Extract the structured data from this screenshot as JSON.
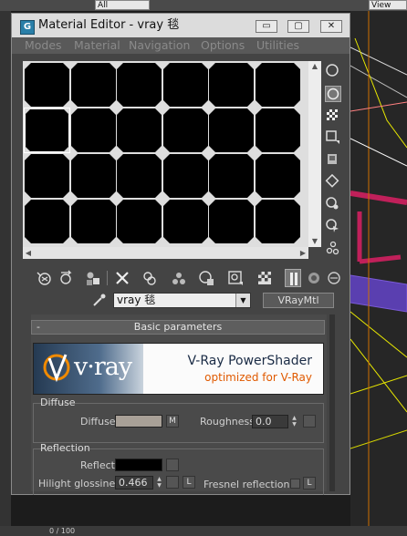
{
  "background": {
    "dropdown_all": "All",
    "dropdown_view": "View",
    "status_text": "0 / 100"
  },
  "window": {
    "title": "Material Editor - vray 毯",
    "icon_letter": "G",
    "controls": {
      "minimize": "▭",
      "maximize": "▢",
      "close": "✕"
    }
  },
  "menu": [
    "Modes",
    "Material",
    "Navigation",
    "Options",
    "Utilities"
  ],
  "samples": {
    "rows": 4,
    "cols": 6,
    "active_index": 6,
    "slot_color": "#000000"
  },
  "right_tools": [
    "sample-type-sphere-icon",
    "backlight-icon",
    "background-checker-icon",
    "sample-uv-tiling-icon",
    "video-color-check-icon",
    "make-preview-icon",
    "options-icon",
    "select-by-material-icon",
    "material-map-navigator-icon"
  ],
  "bottom_tools": [
    "get-material-icon",
    "put-to-scene-icon",
    "assign-to-selection-icon",
    "reset-map-icon",
    "make-unique-icon",
    "put-to-library-icon",
    "material-id-channel-icon",
    "show-map-in-viewport-icon",
    "show-end-result-icon",
    "go-to-parent-icon",
    "go-forward-to-sibling-icon"
  ],
  "material": {
    "name": "vray 毯",
    "type": "VRayMtl"
  },
  "rollout": {
    "minus": "-",
    "title": "Basic parameters"
  },
  "logo": {
    "word": "v·ray",
    "line1": "V-Ray PowerShader",
    "line2": "optimized for V-Ray"
  },
  "diffuse": {
    "group_title": "Diffuse",
    "label": "Diffuse",
    "color": "#a8a097",
    "map_button": "M",
    "roughness_label": "Roughness",
    "roughness_value": "0.0"
  },
  "reflection": {
    "group_title": "Reflection",
    "reflect_label": "Reflect",
    "reflect_color": "#000000",
    "hilight_label": "Hilight glossiness",
    "hilight_value": "0.466",
    "lock_button": "L",
    "fresnel_label": "Fresnel reflections",
    "fresnel_lock": "L"
  }
}
